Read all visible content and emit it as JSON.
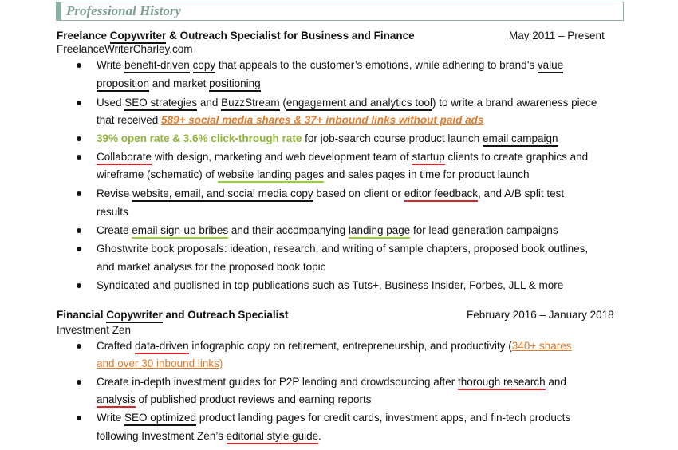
{
  "section": {
    "title": "Professional History"
  },
  "job1": {
    "title_a": "Freelance ",
    "title_b": "Copywriter",
    "title_c": " & Outreach Specialist for Business and Finance",
    "dates": "May 2011  – Present",
    "company": "FreelanceWriterCharley.com",
    "b1": {
      "l1": [
        "Write ",
        "benefit-driven",
        " ",
        "copy",
        " that appeals to the customer’s emotions, while adhering to brand’s ",
        "value"
      ],
      "l2": [
        "proposition",
        " and market ",
        "positioning"
      ]
    },
    "b2": {
      "l1": [
        "Used ",
        "SEO strategies",
        " and ",
        "BuzzStream",
        " (",
        "engagement and analytics tool",
        ") to write a brand awareness piece"
      ],
      "l2": [
        "that received ",
        "589+ social media shares & 37+ inbound links without paid ads"
      ]
    },
    "b3": {
      "l1": [
        "39% open rate & 3.6% click-through rate",
        " for job-search course product launch ",
        "email campaign"
      ]
    },
    "b4": {
      "l1": [
        "Collaborate",
        " with design, marketing and web development team of ",
        "startup",
        " clients to create graphics and"
      ],
      "l2": [
        "wireframe (schematic) of ",
        "website landing pages",
        " and sales pages in time for product launch"
      ]
    },
    "b5": {
      "l1": [
        "Revise ",
        "website, email, and social media copy",
        " based on client or ",
        "editor feedback",
        ", and A/B split test"
      ],
      "l2": [
        "results"
      ]
    },
    "b6": {
      "l1": [
        "Create ",
        "email sign-up bribes",
        " and their accompanying ",
        "landing page",
        " for lead generation campaigns"
      ]
    },
    "b7": {
      "l1": [
        "Ghostwrite book proposals: ideation, research, and writing of sample chapters, proposed book outlines,"
      ],
      "l2": [
        "and market analysis for the proposed book topic"
      ]
    },
    "b8": {
      "l1": [
        "Syndicated and published in top publications such as Tuts+, Business Insider, Forbes, JLL & more"
      ]
    }
  },
  "job2": {
    "title_a": "Financial ",
    "title_b": "Copywriter",
    "title_c": " and Outreach Specialist",
    "dates": "February 2016  – January 2018",
    "company": "Investment Zen",
    "b1": {
      "l1": [
        "Crafted ",
        "data-driven",
        " infographic copy on retirement, entrepreneurship, and productivity (",
        "340+ shares"
      ],
      "l2": [
        "and over 30 inbound links)"
      ]
    },
    "b2": {
      "l1": [
        "Create in-depth investment guides for P2P lending and crowdsourcing after ",
        "thorough research",
        " and"
      ],
      "l2": [
        "analysis",
        " of published product reviews and earning reports"
      ]
    },
    "b3": {
      "l1": [
        "Write ",
        "SEO optimized",
        " product landing pages for credit cards, investment apps, and fin-tech products"
      ],
      "l2": [
        "following Investment Zen’s ",
        "editorial style guide",
        "."
      ]
    }
  },
  "colors": {
    "banner": "#8fb0a6",
    "orange": "#e07b2b",
    "green": "#8fb43a",
    "red_underline": "#d8232a",
    "green_underline": "#9acd32"
  }
}
